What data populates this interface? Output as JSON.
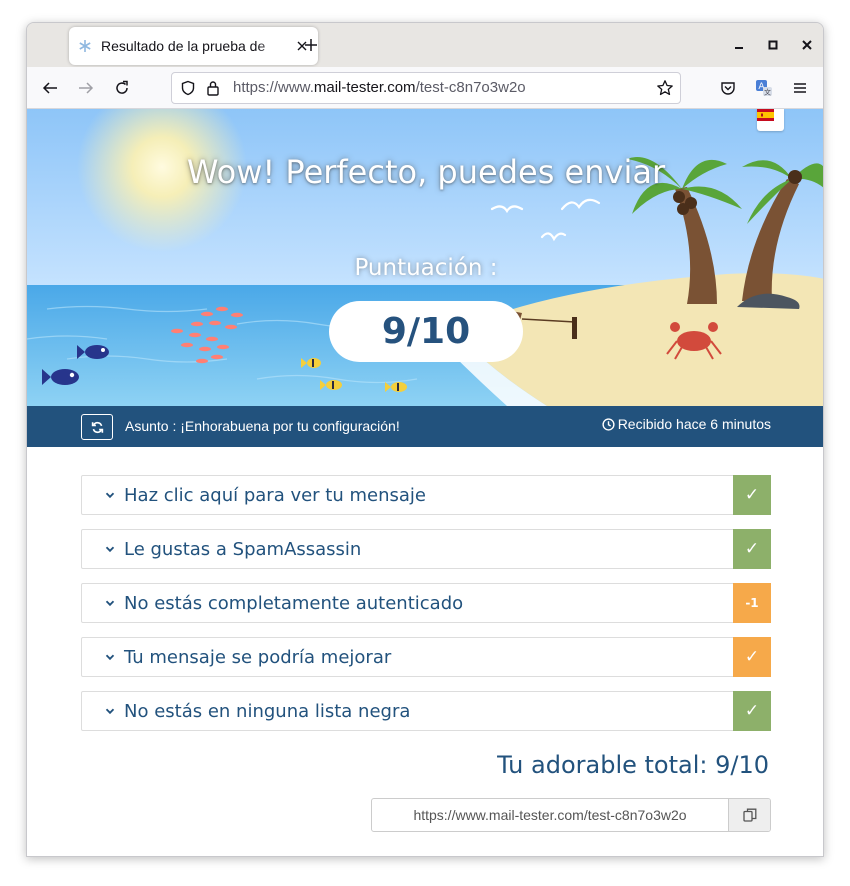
{
  "browser": {
    "tab_title": "Resultado de la prueba de",
    "url_prefix": "https://www.",
    "url_host": "mail-tester.com",
    "url_path": "/test-c8n7o3w2o"
  },
  "hero": {
    "title": "Wow! Perfecto, puedes enviar",
    "score_label": "Puntuación :",
    "score": "9/10"
  },
  "subject_bar": {
    "subject": "Asunto : ¡Enhorabuena por tu configuración!",
    "received": "Recibido hace 6 minutos"
  },
  "panels": [
    {
      "title": "Haz clic aquí para ver tu mensaje",
      "badge": "✓",
      "status_color": "#8db06a"
    },
    {
      "title": "Le gustas a SpamAssassin",
      "badge": "✓",
      "status_color": "#8db06a"
    },
    {
      "title": "No estás completamente autenticado",
      "badge": "-1",
      "status_color": "#f6a94a"
    },
    {
      "title": "Tu mensaje se podría mejorar",
      "badge": "✓",
      "status_color": "#f6a94a"
    },
    {
      "title": "No estás en ninguna lista negra",
      "badge": "✓",
      "status_color": "#8db06a"
    }
  ],
  "total": "Tu adorable total: 9/10",
  "share_link": "https://www.mail-tester.com/test-c8n7o3w2o",
  "colors": {
    "brand_blue": "#22527d",
    "ok_green": "#8db06a",
    "warn_orange": "#f6a94a"
  }
}
